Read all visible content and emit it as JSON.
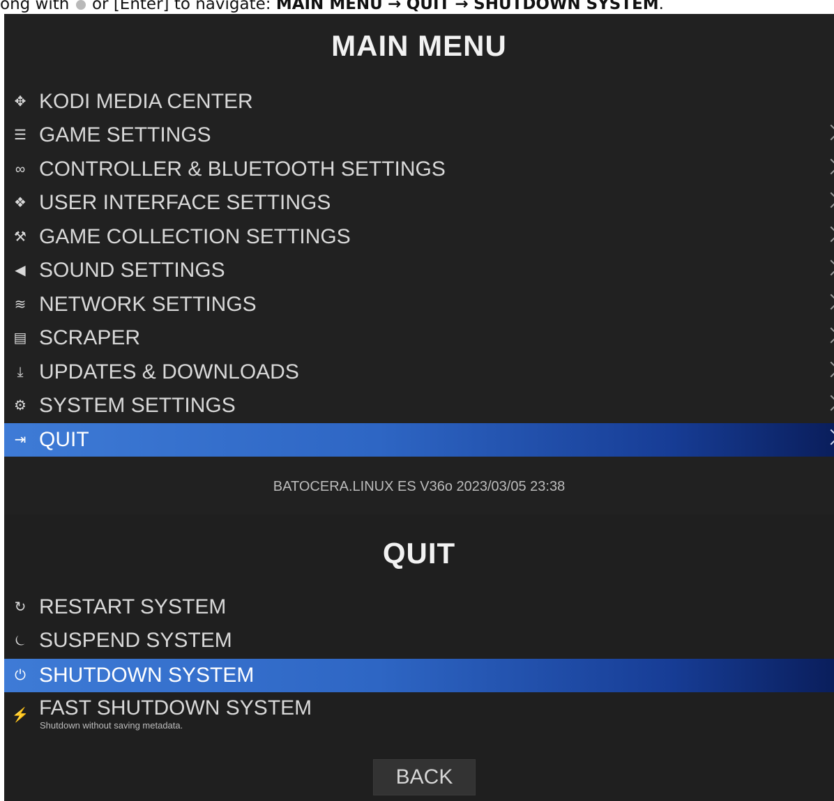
{
  "caption": {
    "prefix": "ong with",
    "middle": "or [Enter] to navigate:",
    "path_main": "MAIN MENU",
    "arrow1": "→",
    "path_quit": "QUIT",
    "arrow2": "→",
    "path_shutdown": "SHUTDOWN SYSTEM",
    "suffix": "."
  },
  "main_menu": {
    "title": "MAIN MENU",
    "items": [
      {
        "label": "KODI MEDIA CENTER",
        "icon": "kodi-icon",
        "glyph": "✥"
      },
      {
        "label": "GAME SETTINGS",
        "icon": "sliders-icon",
        "glyph": "☰"
      },
      {
        "label": "CONTROLLER & BLUETOOTH SETTINGS",
        "icon": "gamepad-icon",
        "glyph": "∞"
      },
      {
        "label": "USER INTERFACE SETTINGS",
        "icon": "ui-settings-icon",
        "glyph": "❖"
      },
      {
        "label": "GAME COLLECTION SETTINGS",
        "icon": "wrench-icon",
        "glyph": "⚒"
      },
      {
        "label": "SOUND SETTINGS",
        "icon": "speaker-icon",
        "glyph": "◀"
      },
      {
        "label": "NETWORK SETTINGS",
        "icon": "wifi-icon",
        "glyph": "≋"
      },
      {
        "label": "SCRAPER",
        "icon": "scraper-icon",
        "glyph": "▤"
      },
      {
        "label": "UPDATES & DOWNLOADS",
        "icon": "download-icon",
        "glyph": "⤓"
      },
      {
        "label": "SYSTEM SETTINGS",
        "icon": "gears-icon",
        "glyph": "⚙"
      },
      {
        "label": "QUIT",
        "icon": "exit-icon",
        "glyph": "⇥"
      }
    ],
    "version": "BATOCERA.LINUX ES V36o 2023/03/05 23:38"
  },
  "quit_menu": {
    "title": "QUIT",
    "items": [
      {
        "label": "RESTART SYSTEM",
        "icon": "restart-icon",
        "glyph": "↻"
      },
      {
        "label": "SUSPEND SYSTEM",
        "icon": "suspend-icon",
        "glyph": "⏾"
      },
      {
        "label": "SHUTDOWN SYSTEM",
        "icon": "power-icon",
        "glyph": "⏻"
      },
      {
        "label": "FAST SHUTDOWN SYSTEM",
        "icon": "fast-power-icon",
        "glyph": "⚡",
        "sublabel": "Shutdown without saving metadata."
      }
    ],
    "back_label": "BACK"
  },
  "colors": {
    "background": "#212121",
    "selection_start": "#3e7bd6",
    "selection_end": "#0a1e5c",
    "text": "#d9d9d9"
  }
}
